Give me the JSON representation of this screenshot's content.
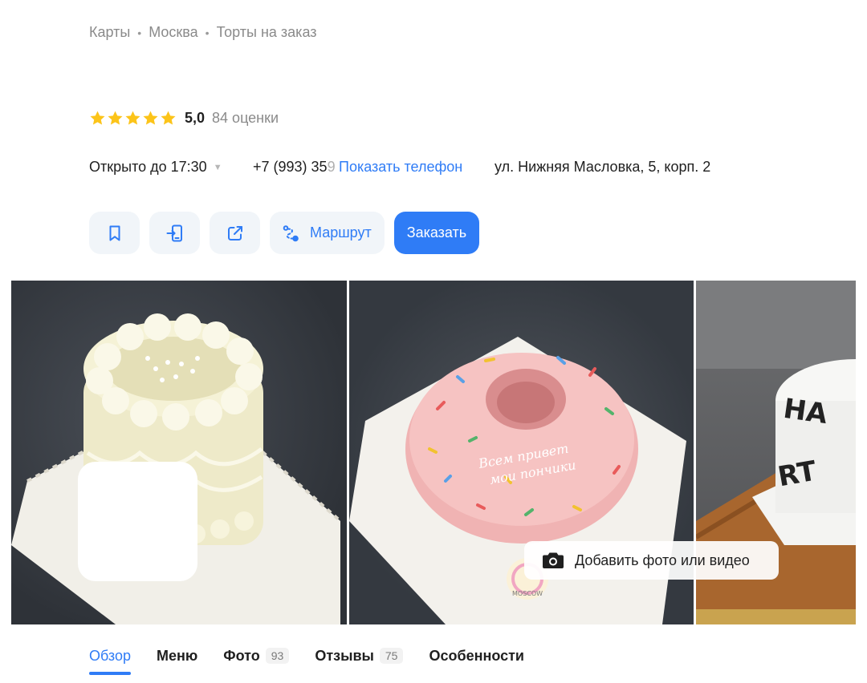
{
  "breadcrumb": {
    "items": [
      "Карты",
      "Москва",
      "Торты на заказ"
    ],
    "separator": "•"
  },
  "rating": {
    "value": "5,0",
    "count_label": "84 оценки",
    "stars": 5,
    "star_color": "#fcc419"
  },
  "info": {
    "hours": "Открыто до 17:30",
    "phone_visible": "+7 (993) 35",
    "phone_faded": "9",
    "show_phone_label": "Показать телефон",
    "address": "ул. Нижняя Масловка, 5, корп. 2"
  },
  "actions": {
    "bookmark_icon": "bookmark-icon",
    "send_to_phone_icon": "send-to-phone-icon",
    "share_icon": "share-icon",
    "route_icon": "route-icon",
    "route_label": "Маршрут",
    "order_label": "Заказать",
    "accent_color": "#2f7cf6"
  },
  "gallery": {
    "photo2_inscription": "Всем привет мои пончики",
    "photo2_stamp": "MOSCOW",
    "photo3_letters": "HA RT",
    "add_photo_label": "Добавить фото или видео",
    "add_photo_icon": "camera-icon"
  },
  "tabs": [
    {
      "label": "Обзор",
      "count": null,
      "active": true
    },
    {
      "label": "Меню",
      "count": null,
      "active": false
    },
    {
      "label": "Фото",
      "count": "93",
      "active": false
    },
    {
      "label": "Отзывы",
      "count": "75",
      "active": false
    },
    {
      "label": "Особенности",
      "count": null,
      "active": false
    }
  ]
}
